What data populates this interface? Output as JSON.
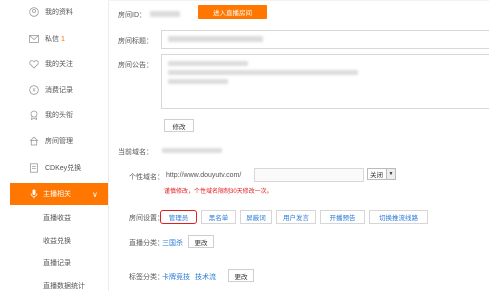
{
  "sidebar": {
    "items": [
      {
        "label": "我的资料",
        "icon": "user-circle-icon"
      },
      {
        "label": "私信",
        "badge": "1",
        "icon": "mail-icon"
      },
      {
        "label": "我的关注",
        "icon": "heart-icon"
      },
      {
        "label": "消费记录",
        "icon": "coin-icon"
      },
      {
        "label": "我的头衔",
        "icon": "medal-icon"
      },
      {
        "label": "房间管理",
        "icon": "house-icon"
      },
      {
        "label": "CDKey兑换",
        "icon": "card-icon"
      },
      {
        "label": "主播相关",
        "icon": "microphone-icon",
        "chevron": "∨"
      }
    ],
    "sub_items": [
      "直播收益",
      "收益兑换",
      "直播记录",
      "直播数据统计"
    ]
  },
  "room": {
    "id_label": "房间ID：",
    "enter_button": "进入直播房间",
    "title_label": "房间标题：",
    "notice_label": "房间公告：",
    "modify_button": "修改",
    "domain_label": "当前域名：",
    "custom_domain_label": "个性域名：",
    "custom_domain_prefix": "http://www.douyutv.com/",
    "custom_domain_select": "关闭",
    "custom_domain_warning": "谨慎修改，个性域名限制30天修改一次。",
    "settings_label": "房间设置：",
    "settings_tabs": [
      "管理员",
      "黑名单",
      "屏蔽词",
      "用户发言",
      "开播预告",
      "切换推流线路"
    ],
    "category_label": "直播分类：",
    "category_value": "三国杀",
    "category_modify": "更改",
    "tags_label": "标签分类：",
    "tags": [
      "卡牌竞技",
      "技术流"
    ],
    "tags_modify": "更改"
  },
  "colors": {
    "accent": "#ff7700",
    "link": "#2a7ad6",
    "warning": "#e02020"
  }
}
